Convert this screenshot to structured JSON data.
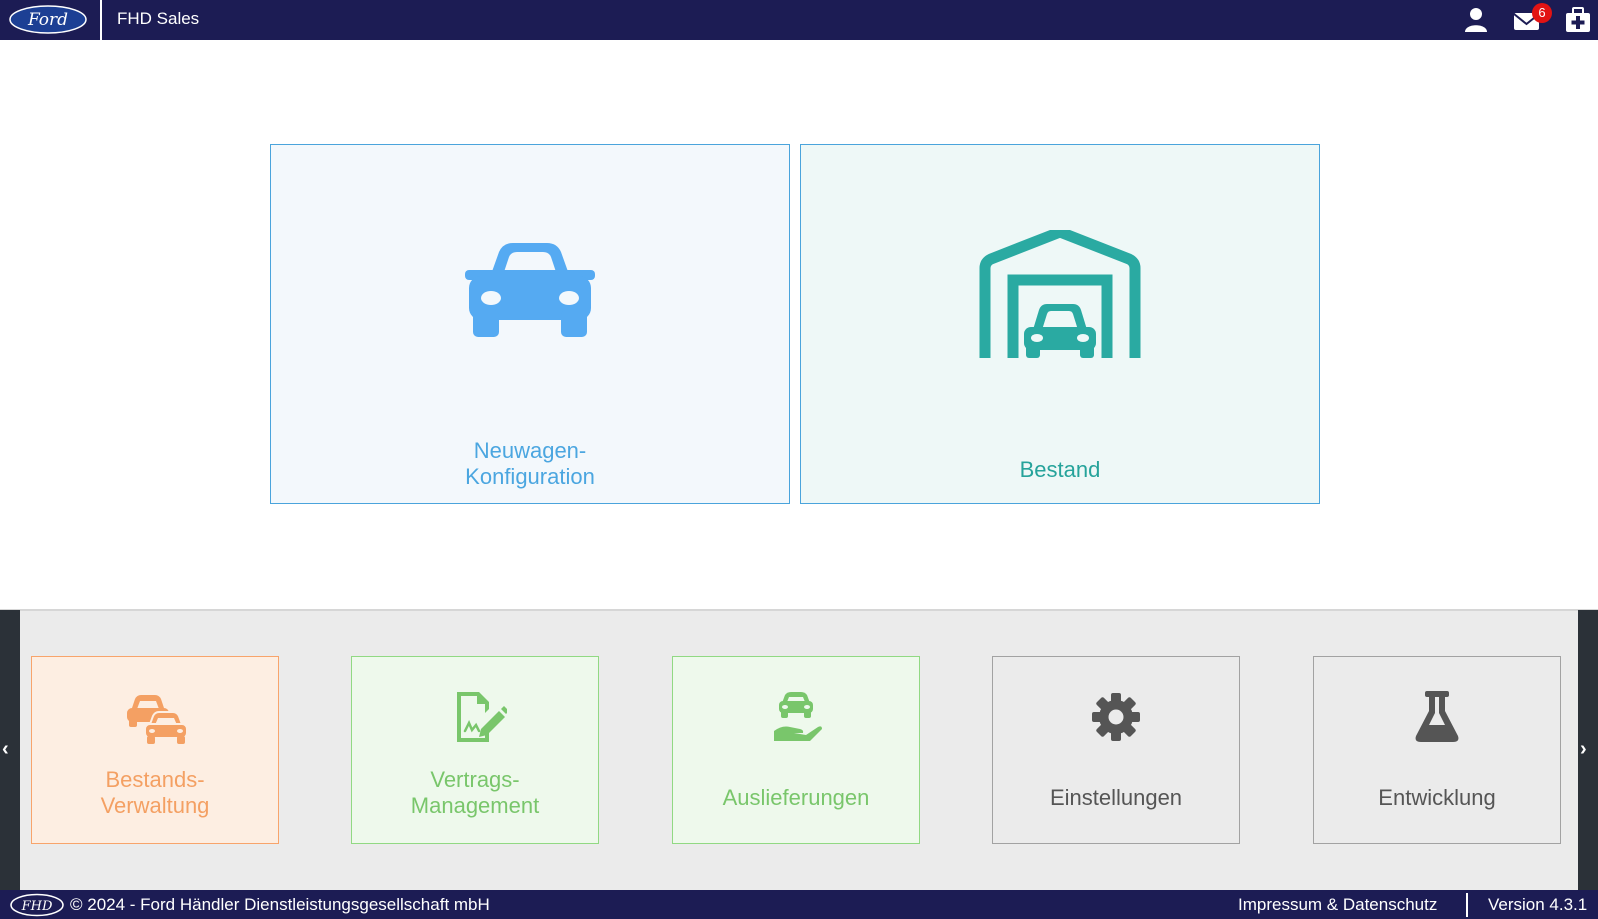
{
  "header": {
    "brand_logo": "Ford",
    "app_title": "FHD Sales",
    "mail_badge_count": "6",
    "icons": [
      "user-icon",
      "mail-icon",
      "first-aid-kit-icon"
    ]
  },
  "main_tiles": [
    {
      "label_line1": "Neuwagen-",
      "label_line2": "Konfiguration",
      "icon": "car-icon",
      "color": "#4ba6e0"
    },
    {
      "label": "Bestand",
      "icon": "garage-car-icon",
      "color": "#26a39b"
    }
  ],
  "quick_tiles": [
    {
      "label_line1": "Bestands-",
      "label_line2": "Verwaltung",
      "icon": "two-cars-icon",
      "color": "#f4a063"
    },
    {
      "label_line1": "Vertrags-",
      "label_line2": "Management",
      "icon": "contract-signature-icon",
      "color": "#79c66b"
    },
    {
      "label": "Auslieferungen",
      "icon": "car-on-hand-icon",
      "color": "#79c66b"
    },
    {
      "label": "Einstellungen",
      "icon": "gear-icon",
      "color": "#555555"
    },
    {
      "label": "Entwicklung",
      "icon": "flask-icon",
      "color": "#555555"
    }
  ],
  "nav": {
    "left": "‹",
    "right": "›"
  },
  "footer": {
    "logo_text": "FHD",
    "copyright": "© 2024 - Ford Händler Dienstleistungsgesellschaft mbH",
    "imprint_link": "Impressum & Datenschutz",
    "version": "Version 4.3.1"
  },
  "colors": {
    "header_bg": "#1c1c54",
    "badge": "#e21313",
    "panel_bg": "#ebebeb"
  }
}
